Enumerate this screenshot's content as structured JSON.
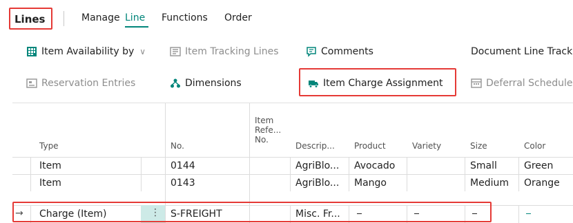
{
  "tabs": {
    "lines": "Lines",
    "manage": "Manage",
    "line": "Line",
    "functions": "Functions",
    "order": "Order"
  },
  "actions": {
    "item_availability": "Item Availability by",
    "item_tracking_lines": "Item Tracking Lines",
    "comments": "Comments",
    "document_line_tracking": "Document Line Track",
    "reservation_entries": "Reservation Entries",
    "dimensions": "Dimensions",
    "item_charge_assignment": "Item Charge Assignment",
    "deferral_schedule": "Deferral Schedule"
  },
  "table": {
    "headers": {
      "type": "Type",
      "no": "No.",
      "item_ref_1": "Item",
      "item_ref_2": "Refe...",
      "item_ref_3": "No.",
      "description": "Descrip...",
      "product": "Product",
      "variety": "Variety",
      "size": "Size",
      "color": "Color"
    },
    "rows": [
      {
        "type": "Item",
        "no": "0144",
        "item_ref": "",
        "description": "AgriBlo...",
        "product": "Avocado",
        "variety": "",
        "size": "Small",
        "color": "Green"
      },
      {
        "type": "Item",
        "no": "0143",
        "item_ref": "",
        "description": "AgriBlo...",
        "product": "Mango",
        "variety": "",
        "size": "Medium",
        "color": "Orange"
      },
      {
        "type": "Charge (Item)",
        "no": "S-FREIGHT",
        "item_ref": "",
        "description": "Misc. Fr...",
        "product": "",
        "variety": "",
        "size": "",
        "color": "",
        "selected_marker": "→",
        "menu_dots": "⋮"
      }
    ]
  },
  "colors": {
    "accent": "#00857a",
    "highlight": "#e53935",
    "selected_cell": "#cdeae7"
  }
}
